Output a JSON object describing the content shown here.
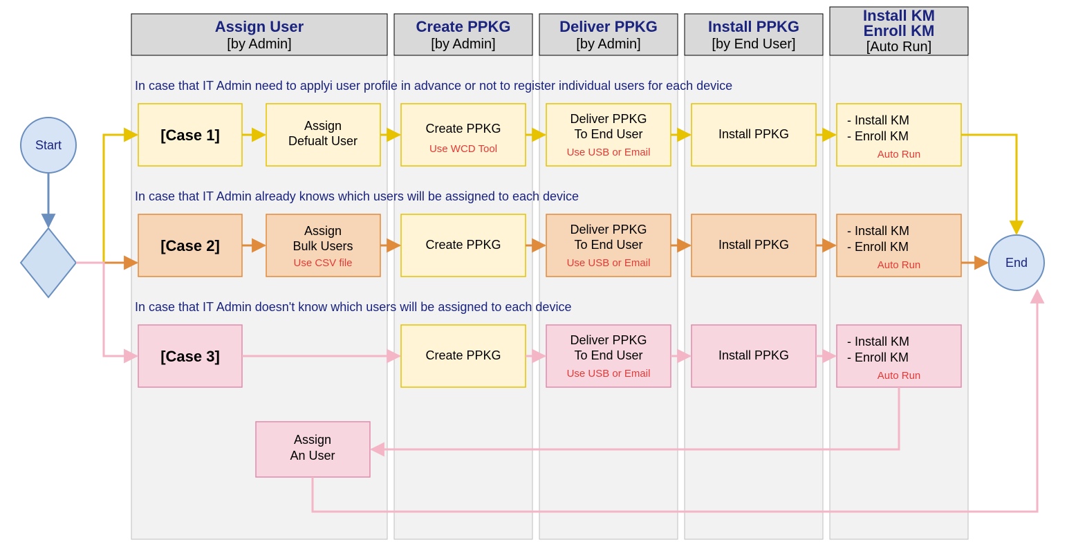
{
  "lanes": [
    {
      "title": "Assign User",
      "sub": "[by Admin]"
    },
    {
      "title": "Create PPKG",
      "sub": "[by Admin]"
    },
    {
      "title": "Deliver PPKG",
      "sub": "[by Admin]"
    },
    {
      "title": "Install PPKG",
      "sub": "[by End User]"
    },
    {
      "title": "Install KM",
      "title2": "Enroll KM",
      "sub": "[Auto Run]"
    }
  ],
  "notes": {
    "case1": "In case that IT Admin need to applyi user profile in advance or not to register individual users for each device",
    "case2": "In case that IT Admin already knows which users will be assigned to each device",
    "case3": "In case that IT Admin doesn't know which users will be assigned to each device"
  },
  "labels": {
    "start": "Start",
    "end": "End",
    "case1": "[Case 1]",
    "case2": "[Case 2]",
    "case3": "[Case 3]",
    "assignDefault1": "Assign",
    "assignDefault2": "Defualt User",
    "assignBulk1": "Assign",
    "assignBulk2": "Bulk Users",
    "assignBulkSub": "Use CSV file",
    "assignAn1": "Assign",
    "assignAn2": "An User",
    "createPPKG": "Create PPKG",
    "createSub": "Use WCD Tool",
    "deliver1": "Deliver PPKG",
    "deliver2": "To End User",
    "deliverSub": "Use USB or Email",
    "install": "Install PPKG",
    "km1": "- Install KM",
    "km2": "- Enroll KM",
    "kmSub": "Auto Run"
  }
}
